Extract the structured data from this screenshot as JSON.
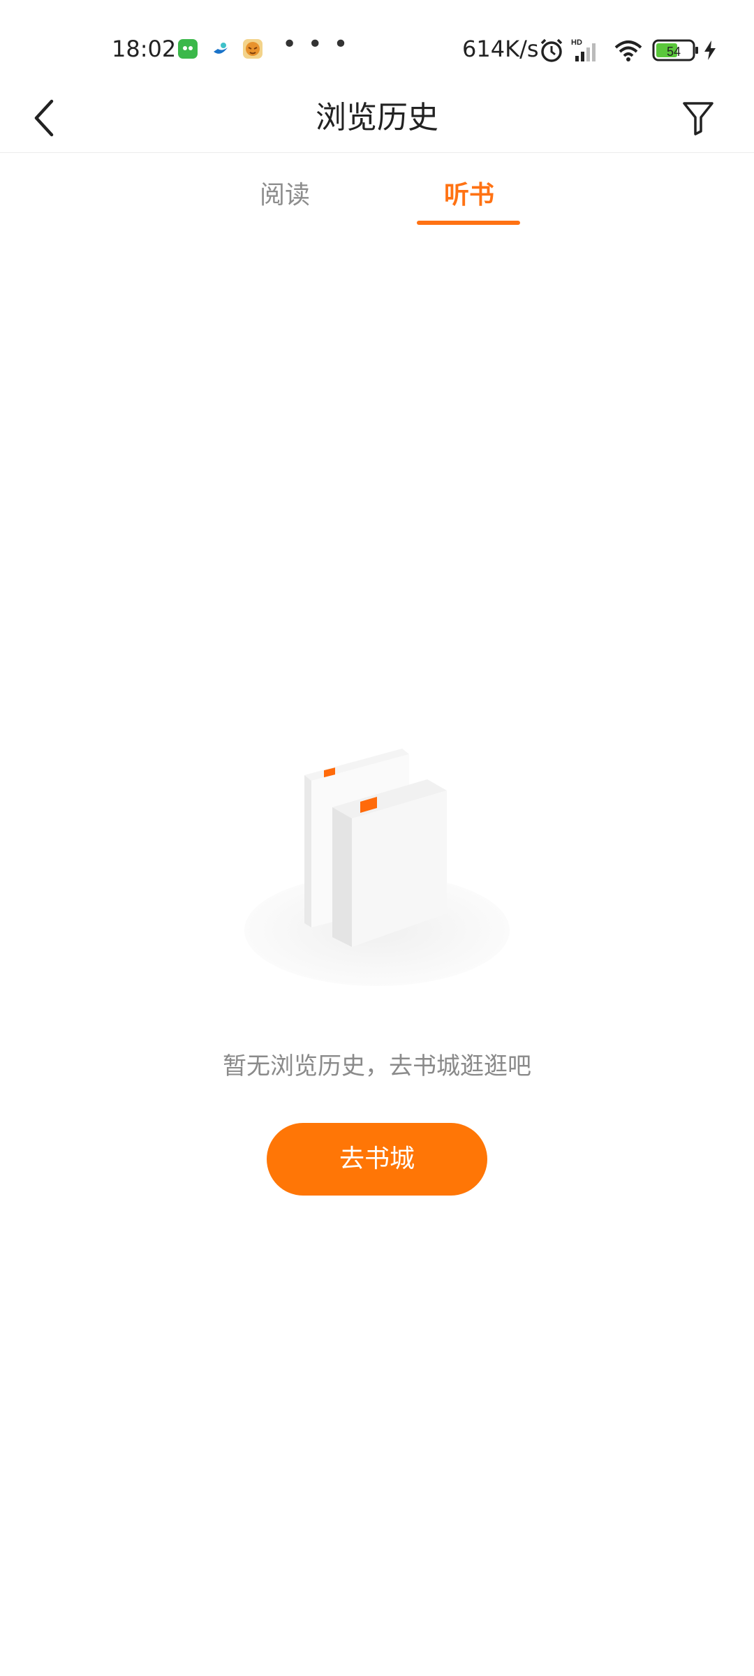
{
  "status_bar": {
    "time": "18:02",
    "more_dots": "• • •",
    "network_speed": "614K/s",
    "battery_level": "54",
    "icons": [
      "wechat-icon",
      "app-icon",
      "tiger-app-icon",
      "alarm-icon",
      "signal-icon",
      "wifi-icon",
      "battery-icon",
      "charging-icon"
    ],
    "colors": {
      "battery_fill": "#5ac73b"
    }
  },
  "header": {
    "title": "浏览历史",
    "back_icon": "chevron-left-icon",
    "filter_icon": "filter-icon"
  },
  "tabs": {
    "items": [
      {
        "label": "阅读",
        "active": false
      },
      {
        "label": "听书",
        "active": true
      }
    ],
    "colors": {
      "active": "#ff7213",
      "inactive": "#8d8d8d"
    }
  },
  "empty_state": {
    "illustration": "books-icon",
    "message": "暂无浏览历史，去书城逛逛吧",
    "button_label": "去书城"
  },
  "colors": {
    "accent": "#ff7606"
  }
}
